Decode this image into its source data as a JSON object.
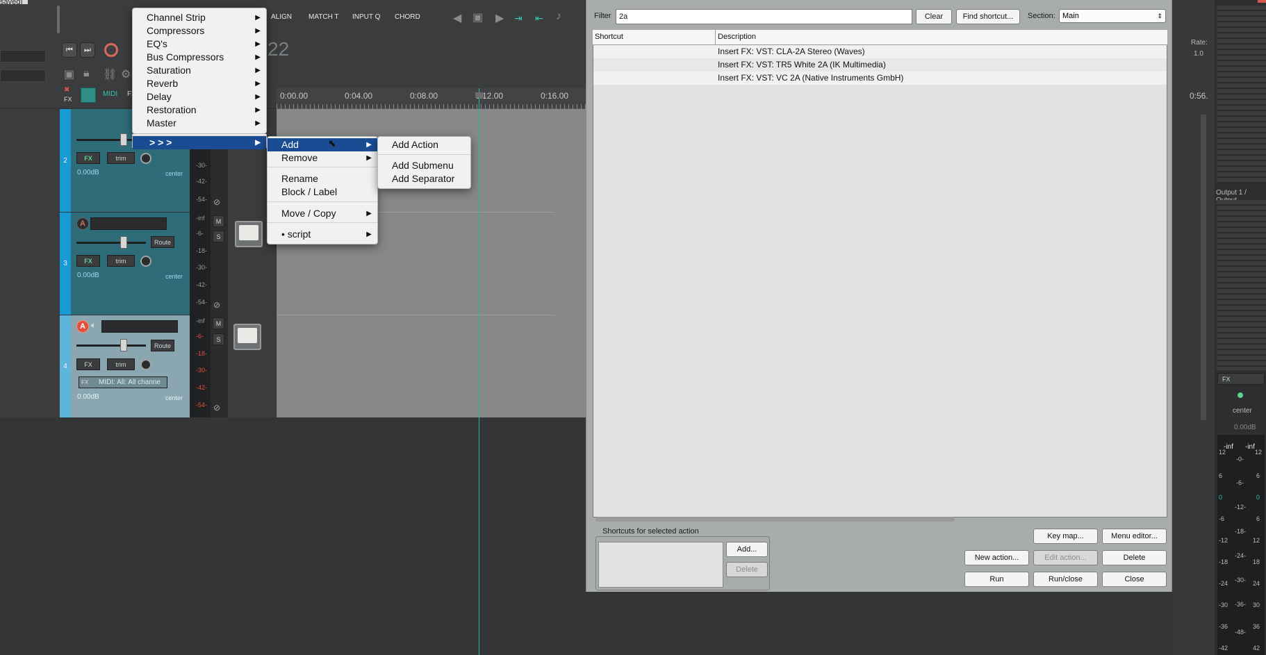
{
  "window": {
    "title_fragment": "saved]"
  },
  "toolbar": {
    "align": "ALIGN",
    "match_t": "MATCH T",
    "input_q": "INPUT Q",
    "chord": "CHORD",
    "time_display": "22",
    "fx_label": "FX",
    "midi_label": "MIDI",
    "fx_label2": "FX"
  },
  "ruler": {
    "labels": [
      "0:00.00",
      "0:04.00",
      "0:08.00",
      "0:12.00",
      "0:16.00",
      "0:56."
    ]
  },
  "tracks": [
    {
      "number": "2",
      "volume": "0.00dB",
      "pan": "center",
      "fx": "FX",
      "trim": "trim",
      "route": ""
    },
    {
      "number": "3",
      "volume": "0.00dB",
      "pan": "center",
      "fx": "FX",
      "trim": "trim",
      "route": "Route"
    },
    {
      "number": "4",
      "volume": "0.00dB",
      "pan": "center",
      "fx": "FX",
      "trim": "trim",
      "route": "Route",
      "midi": "MIDI: All: All channe"
    }
  ],
  "meter_labels": {
    "t2": [
      "-30-",
      "-42-",
      "-54-"
    ],
    "t3": [
      "-inf",
      "-6-",
      "-18-",
      "-30-",
      "-42-",
      "-54-"
    ],
    "t4": [
      "-inf",
      "-6-",
      "-18-",
      "-30-",
      "-42-",
      "-54-"
    ]
  },
  "mute_solo": {
    "mute": "M",
    "solo": "S"
  },
  "menu1": {
    "items": [
      "Channel Strip",
      "Compressors",
      "EQ's",
      "Bus Compressors",
      "Saturation",
      "Reverb",
      "Delay",
      "Restoration",
      "Master"
    ],
    "selected": "> > >"
  },
  "menu2": {
    "add": "Add",
    "remove": "Remove",
    "rename": "Rename",
    "block_label": "Block / Label",
    "move_copy": "Move / Copy",
    "script": "• script"
  },
  "menu3": {
    "add_action": "Add Action",
    "add_submenu": "Add Submenu",
    "add_separator": "Add Separator"
  },
  "actions_dialog": {
    "filter_label": "Filter",
    "filter_value": "2a",
    "clear": "Clear",
    "find_shortcut": "Find shortcut...",
    "section_label": "Section:",
    "section_value": "Main",
    "col_shortcut": "Shortcut",
    "col_description": "Description",
    "rows": [
      "Insert FX: VST: CLA-2A Stereo (Waves)",
      "Insert FX: VST: TR5 White 2A (IK Multimedia)",
      "Insert FX: VST: VC 2A (Native Instruments GmbH)"
    ],
    "shortcuts_group": "Shortcuts for selected action",
    "add": "Add...",
    "delete_shortcut": "Delete",
    "key_map": "Key map...",
    "menu_editor": "Menu editor...",
    "new_action": "New action...",
    "edit_action": "Edit action...",
    "delete": "Delete",
    "run": "Run",
    "run_close": "Run/close",
    "close": "Close"
  },
  "right_mixer": {
    "rate_label": "Rate:",
    "rate_value": "1.0",
    "output": "Output 1 / Output",
    "fx": "FX",
    "center": "center",
    "db": "0.00dB",
    "inf1": "-inf",
    "inf2": "-inf",
    "scale_left": [
      "12",
      "6",
      "0",
      "-6",
      "-12",
      "-18",
      "-24",
      "-30",
      "-36",
      "-42"
    ],
    "scale_mid": [
      "-0-",
      "-6-",
      "-12-",
      "-18-",
      "-24-",
      "-30-",
      "-36-",
      "-48-"
    ],
    "scale_right": [
      "12",
      "6",
      "0",
      "6",
      "12",
      "18",
      "24",
      "30",
      "36",
      "42"
    ]
  },
  "colors": {
    "selection": "#1a4c93",
    "track_teal": "#2f6c7a",
    "cursor": "#2ab7a6",
    "arm_red": "#e0513a"
  }
}
